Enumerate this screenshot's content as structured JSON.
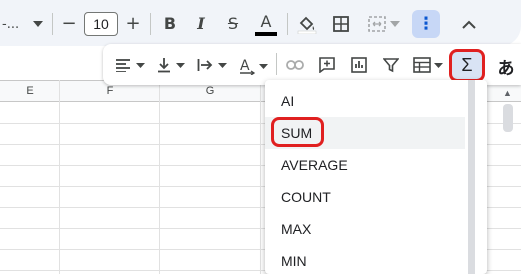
{
  "toolbar_top": {
    "font_dropdown_label": "-...",
    "font_size": "10",
    "minus_label": "−",
    "plus_label": "+",
    "bold_label": "B",
    "italic_label": "I",
    "strike_label": "S",
    "text_color_label": "A",
    "text_color": "#000000",
    "more_label": "⋮",
    "collapse_label": "˄"
  },
  "toolbar_overflow": {
    "sum_label": "Σ",
    "input_tools_label": "あ"
  },
  "grid": {
    "columns": [
      "E",
      "F",
      "G"
    ]
  },
  "function_menu": {
    "items": [
      "AI",
      "SUM",
      "AVERAGE",
      "COUNT",
      "MAX",
      "MIN"
    ],
    "highlighted": "SUM"
  },
  "colors": {
    "highlight_outline": "#e02020",
    "toolbar_bg": "#f1f4f9",
    "active_button": "#c7d7f6"
  }
}
